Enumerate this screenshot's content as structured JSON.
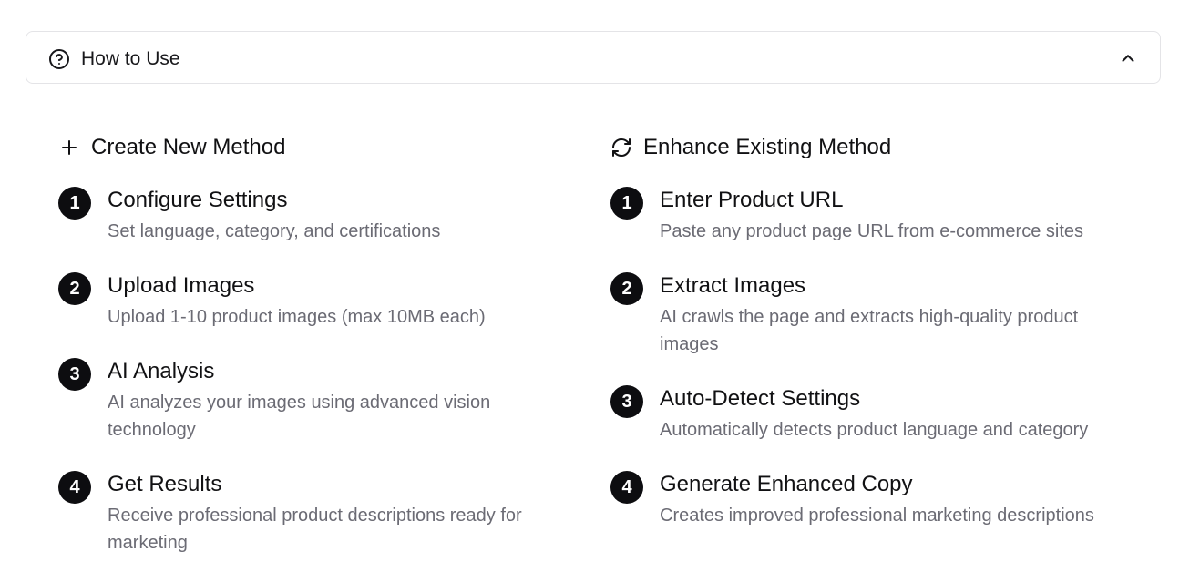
{
  "accordion": {
    "title": "How to Use",
    "help_icon": "help-circle-icon",
    "toggle_icon": "chevron-up-icon"
  },
  "create_method": {
    "icon": "plus-icon",
    "title": "Create New Method",
    "steps": [
      {
        "number": "1",
        "title": "Configure Settings",
        "description": "Set language, category, and certifications"
      },
      {
        "number": "2",
        "title": "Upload Images",
        "description": "Upload 1-10 product images (max 10MB each)"
      },
      {
        "number": "3",
        "title": "AI Analysis",
        "description": "AI analyzes your images using advanced vision technology"
      },
      {
        "number": "4",
        "title": "Get Results",
        "description": "Receive professional product descriptions ready for marketing"
      }
    ]
  },
  "enhance_method": {
    "icon": "refresh-icon",
    "title": "Enhance Existing Method",
    "steps": [
      {
        "number": "1",
        "title": "Enter Product URL",
        "description": "Paste any product page URL from e-commerce sites"
      },
      {
        "number": "2",
        "title": "Extract Images",
        "description": "AI crawls the page and extracts high-quality product images"
      },
      {
        "number": "3",
        "title": "Auto-Detect Settings",
        "description": "Automatically detects product language and category"
      },
      {
        "number": "4",
        "title": "Generate Enhanced Copy",
        "description": "Creates improved professional marketing descriptions"
      }
    ]
  },
  "colors": {
    "badge_bg": "#0d0d10",
    "text_primary": "#111113",
    "text_muted": "#6b6b74",
    "border": "#e4e4e7"
  }
}
